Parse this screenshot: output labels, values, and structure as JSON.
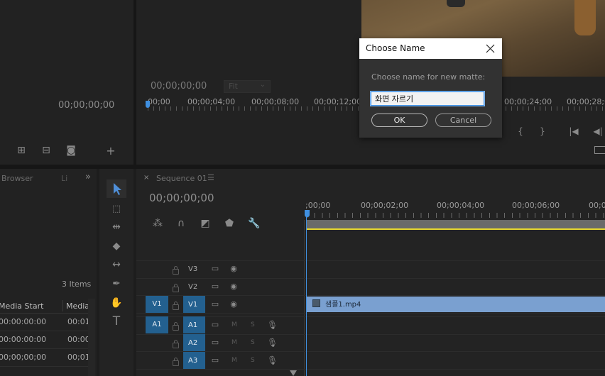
{
  "source_monitor": {
    "timecode": "00;00;00;00"
  },
  "program_monitor": {
    "timecode": "00;00;00;00",
    "zoom": "Fit",
    "ruler_labels": [
      "00;00",
      "00;00;04;00",
      "00;00;08;00",
      "00;00;12;00",
      "00;00;24;00",
      "00;00;28;0"
    ]
  },
  "project_panel": {
    "tab_browser": "Browser",
    "tab_li": "Li",
    "items_count": "3 Items",
    "columns": [
      "Media Start",
      "Media"
    ],
    "rows": [
      [
        "00:00:00:00",
        "00:01"
      ],
      [
        "00:00:00:00",
        "00:00"
      ],
      [
        "00;00;00;00",
        "00;01"
      ]
    ]
  },
  "timeline": {
    "tab_title": "Sequence 01",
    "timecode": "00;00;00;00",
    "ruler_labels": [
      ";00;00",
      "00;00;02;00",
      "00;00;04;00",
      "00;00;06;00",
      "00;0"
    ],
    "video_tracks": [
      "V3",
      "V2",
      "V1"
    ],
    "audio_tracks": [
      "A1",
      "A2",
      "A3"
    ],
    "source_v": "V1",
    "source_a": "A1",
    "clip_name": "샘플1.mp4",
    "mute_label": "M",
    "solo_label": "S"
  },
  "dialog": {
    "title": "Choose Name",
    "prompt": "Choose name for new matte:",
    "input_value": "화면 자르기",
    "ok_label": "OK",
    "cancel_label": "Cancel"
  },
  "colors": {
    "accent_blue": "#23608f",
    "clip_blue": "#7aa0d0",
    "playhead": "#3f8fe0",
    "work_area_yellow": "#e8d830"
  }
}
